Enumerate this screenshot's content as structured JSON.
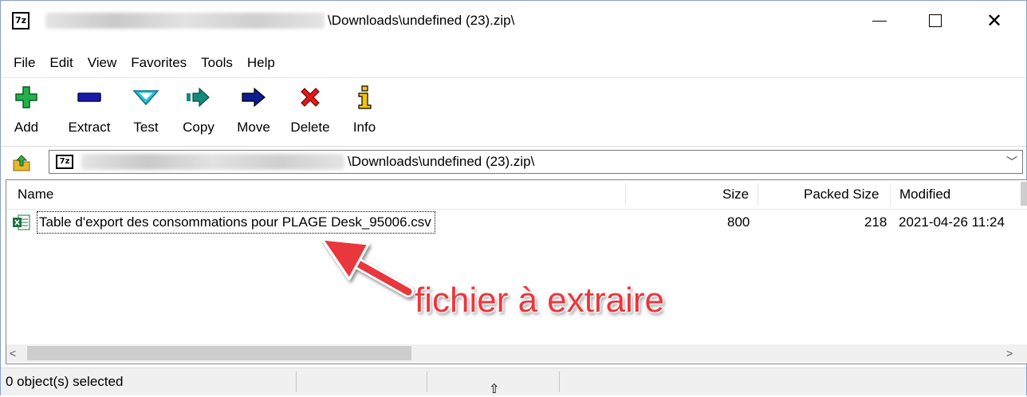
{
  "window": {
    "title_prefix": "7z",
    "title_path": "\\Downloads\\undefined (23).zip\\",
    "controls": {
      "minimize": "—",
      "maximize": "☐",
      "close": "✕"
    }
  },
  "menu": [
    "File",
    "Edit",
    "View",
    "Favorites",
    "Tools",
    "Help"
  ],
  "toolbar": [
    {
      "label": "Add",
      "icon": "add-plus-icon",
      "color": "#22b14c"
    },
    {
      "label": "Extract",
      "icon": "extract-minus-icon",
      "color": "#1a1aaa"
    },
    {
      "label": "Test",
      "icon": "test-chevron-icon",
      "color": "#29c3d9"
    },
    {
      "label": "Copy",
      "icon": "copy-arrow-icon",
      "color": "#138a7a"
    },
    {
      "label": "Move",
      "icon": "move-arrow-icon",
      "color": "#0a1f8f"
    },
    {
      "label": "Delete",
      "icon": "delete-x-icon",
      "color": "#e01b1b"
    },
    {
      "label": "Info",
      "icon": "info-i-icon",
      "color": "#f2c511"
    }
  ],
  "address": {
    "icon_text": "7z",
    "path": "\\Downloads\\undefined (23).zip\\"
  },
  "columns": [
    "Name",
    "Size",
    "Packed Size",
    "Modified"
  ],
  "files": [
    {
      "name": "Table d'export des consommations pour PLAGE Desk_95006.csv",
      "size": "800",
      "packed_size": "218",
      "modified": "2021-04-26 11:24"
    }
  ],
  "scrollbar": {
    "left": "<",
    "right": ">"
  },
  "status": {
    "selection": "0 object(s) selected"
  },
  "annotation": {
    "text": "fichier à extraire",
    "color": "#e8383d"
  }
}
